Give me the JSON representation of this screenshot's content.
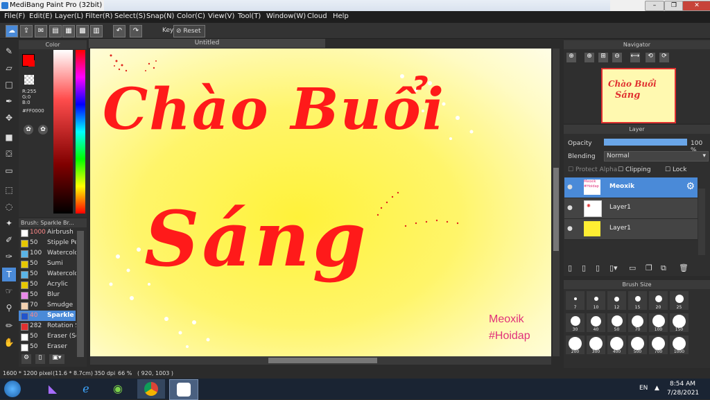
{
  "window": {
    "title": "MediBang Paint Pro (32bit)",
    "min": "–",
    "max": "❐",
    "close": "✕"
  },
  "menu": [
    "File(F)",
    "Edit(E)",
    "Layer(L)",
    "Filter(R)",
    "Select(S)",
    "Snap(N)",
    "Color(C)",
    "View(V)",
    "Tool(T)",
    "Window(W)",
    "Cloud",
    "Help"
  ],
  "toolbar": {
    "key_label": "Key",
    "reset_label": "Reset"
  },
  "color_panel": {
    "title": "Color",
    "r": "R:255",
    "g": "G:0",
    "b": "B:0",
    "hex": "#FF0000"
  },
  "canvas": {
    "tab_title": "Untitled",
    "line1": "Chào Buổi",
    "line2": "Sáng",
    "signature1": "Meoxik",
    "signature2": "#Hoidap"
  },
  "brush_panel": {
    "title": "Brush: Sparkle Br...",
    "items": [
      {
        "size": "1000",
        "name": "Airbrush",
        "color": "#ffffff"
      },
      {
        "size": "50",
        "name": "Stipple Pe",
        "color": "#e6c800"
      },
      {
        "size": "100",
        "name": "Watercolo",
        "color": "#5ab4e6"
      },
      {
        "size": "50",
        "name": "Sumi",
        "color": "#e6c800"
      },
      {
        "size": "50",
        "name": "Watercolo",
        "color": "#5ab4e6"
      },
      {
        "size": "50",
        "name": "Acrylic",
        "color": "#e6c800"
      },
      {
        "size": "50",
        "name": "Blur",
        "color": "#e88ae8"
      },
      {
        "size": "70",
        "name": "Smudge",
        "color": "#f2d0b0"
      },
      {
        "size": "40",
        "name": "Sparkle",
        "color": "#2255cc"
      },
      {
        "size": "282",
        "name": "Rotation S",
        "color": "#e03030"
      },
      {
        "size": "50",
        "name": "Eraser (Sc",
        "color": "#ffffff"
      },
      {
        "size": "50",
        "name": "Eraser",
        "color": "#ffffff"
      }
    ]
  },
  "navigator": {
    "title": "Navigator",
    "thumb_line1": "Chào Buổi",
    "thumb_line2": "Sáng"
  },
  "layer_panel": {
    "title": "Layer",
    "opacity_label": "Opacity",
    "opacity_value": "100 %",
    "opacity_fraction": 1.0,
    "blending_label": "Blending",
    "blending_value": "Normal",
    "protect_alpha": "Protect Alpha",
    "clipping": "Clipping",
    "lock": "Lock",
    "layers": [
      {
        "name": "Meoxik",
        "thumb1": "Meoxik",
        "thumb2": "#Hoidap"
      },
      {
        "name": "Layer1"
      },
      {
        "name": "Layer1"
      }
    ]
  },
  "brush_size": {
    "title": "Brush Size",
    "sizes": [
      "7",
      "10",
      "12",
      "15",
      "20",
      "25",
      "30",
      "40",
      "50",
      "70",
      "100",
      "150",
      "200",
      "300",
      "400",
      "500",
      "700",
      "1000"
    ]
  },
  "status": {
    "size": "1600 * 1200 pixel",
    "cm": "(11.6 * 8.7cm)",
    "dpi": "350 dpi",
    "zoom": "66 %",
    "coords": "( 920, 1003 )"
  },
  "taskbar": {
    "lang": "EN",
    "time": "8:54 AM",
    "date": "7/28/2021"
  },
  "colors": {
    "accent": "#4a8ad8",
    "text_red": "#ff1a1a",
    "signature": "#e0307a"
  }
}
